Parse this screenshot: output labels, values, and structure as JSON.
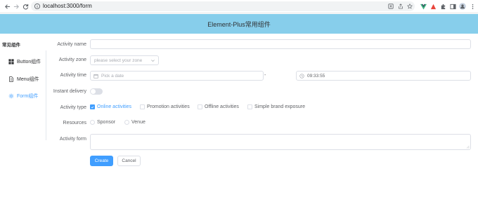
{
  "browser": {
    "url": "localhost:3000/form",
    "back_icon": "arrow-left-icon",
    "forward_icon": "arrow-right-icon",
    "reload_icon": "reload-icon",
    "lock_icon": "info-icon",
    "omnibox_icons": [
      "translate-icon",
      "share-icon",
      "star-icon"
    ],
    "extension_icons": [
      "vue-devtools-icon",
      "extension-red-icon",
      "puzzle-icon",
      "sidepanel-icon",
      "profile-icon",
      "menu-dots-icon"
    ]
  },
  "header": {
    "title": "Element-Plus常用组件",
    "background": "#87ceeb"
  },
  "sidebar": {
    "title": "常见组件",
    "items": [
      {
        "label": "Button组件",
        "icon": "grid-icon",
        "active": false
      },
      {
        "label": "Menu组件",
        "icon": "document-icon",
        "active": false
      },
      {
        "label": "Form组件",
        "icon": "gear-icon",
        "active": true
      }
    ]
  },
  "form": {
    "activity_name": {
      "label": "Activity name",
      "value": ""
    },
    "activity_zone": {
      "label": "Activity zone",
      "placeholder": "please select your zone"
    },
    "activity_time": {
      "label": "Activity time",
      "date_placeholder": "Pick a date",
      "separator": "-",
      "time_value": "09:33:55"
    },
    "instant_delivery": {
      "label": "Instant delivery",
      "on": false
    },
    "activity_type": {
      "label": "Activity type",
      "options": [
        {
          "label": "Online activities",
          "checked": true
        },
        {
          "label": "Promotion activities",
          "checked": false
        },
        {
          "label": "Offline activities",
          "checked": false
        },
        {
          "label": "Simple brand exposure",
          "checked": false
        }
      ]
    },
    "resources": {
      "label": "Resources",
      "options": [
        {
          "label": "Sponsor"
        },
        {
          "label": "Venue"
        }
      ]
    },
    "activity_form": {
      "label": "Activity form",
      "value": ""
    },
    "create_label": "Create",
    "cancel_label": "Cancel"
  },
  "colors": {
    "primary": "#409eff",
    "header": "#87ceeb",
    "border": "#dcdfe6"
  }
}
